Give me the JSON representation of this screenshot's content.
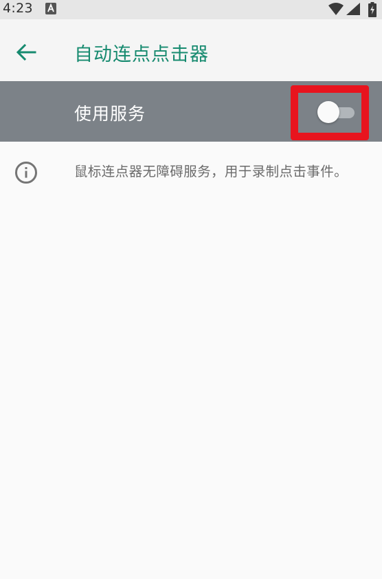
{
  "status_bar": {
    "time": "4:23",
    "icons": [
      "a-notification-icon",
      "wifi-icon",
      "cell-signal-icon",
      "battery-charging-icon"
    ]
  },
  "app_bar": {
    "title": "自动连点点击器",
    "back_icon": "arrow-back-icon",
    "accent_color": "#168a6f"
  },
  "service": {
    "label": "使用服务",
    "toggle_state": "off",
    "row_color": "#7c8288",
    "highlight_color": "#e8141e"
  },
  "info": {
    "icon": "info-icon",
    "description": "鼠标连点器无障碍服务，用于录制点击事件。"
  }
}
